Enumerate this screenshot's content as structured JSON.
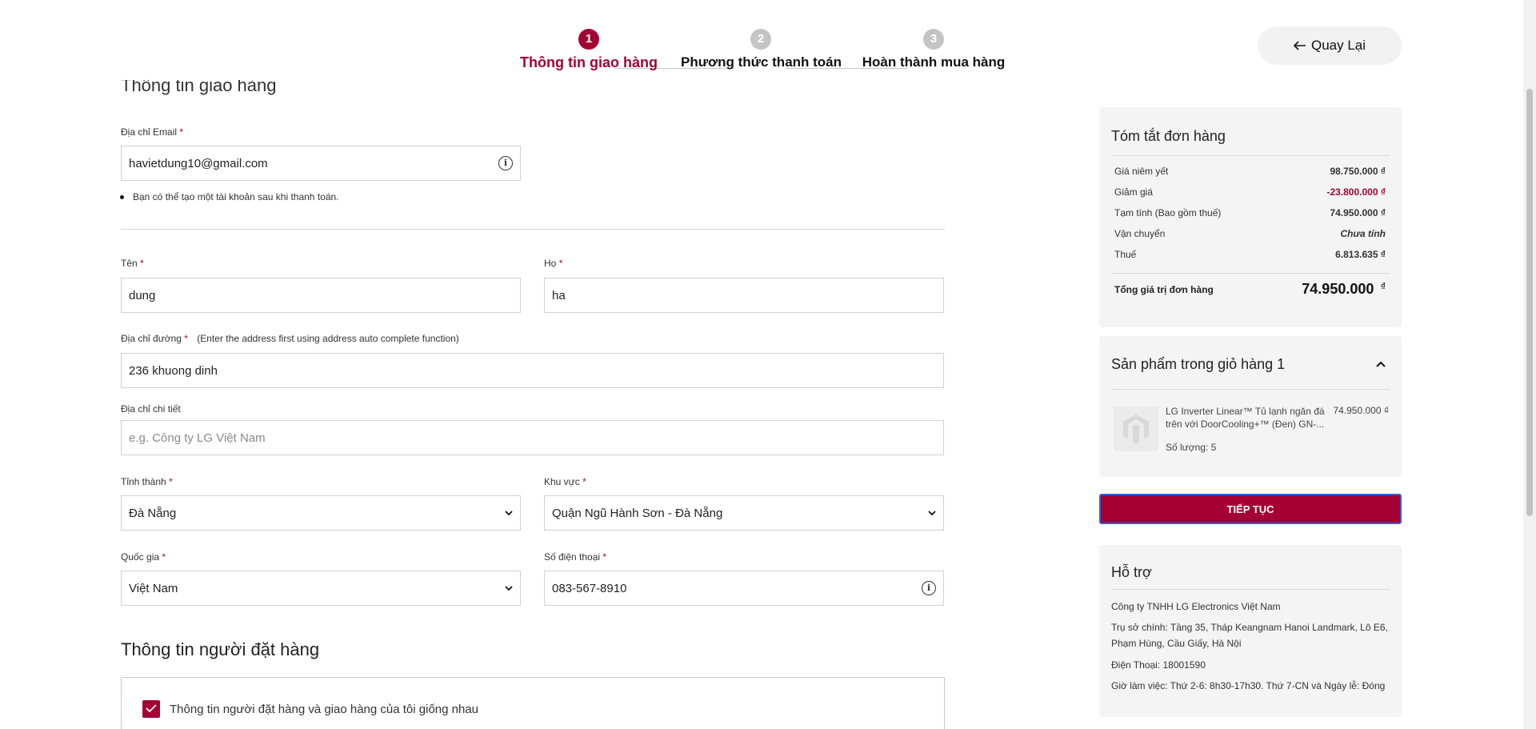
{
  "stepper": {
    "steps": [
      {
        "number": "1",
        "label": "Thông tin giao hàng"
      },
      {
        "number": "2",
        "label": "Phương thức thanh toán"
      },
      {
        "number": "3",
        "label": "Hoàn thành mua hàng"
      }
    ],
    "active_step": 1
  },
  "back_button": {
    "label": "Quay Lại",
    "icon": "arrow-left-icon"
  },
  "shipping": {
    "title": "Thông tin giao hàng",
    "email_label": "Địa chỉ Email",
    "email_value": "havietdung10@gmail.com",
    "email_hint": "Bạn có thể tạo một tài khoản sau khi thanh toán.",
    "first_name_label": "Tên",
    "first_name_value": "dung",
    "last_name_label": "Họ",
    "last_name_value": "ha",
    "street_label": "Địa chỉ đường",
    "street_note": "(Enter the address first using address auto complete function)",
    "street_value": "236 khuong dinh",
    "detail_label": "Địa chỉ chi tiết",
    "detail_placeholder": "e.g. Công ty LG Việt Nam",
    "province_label": "Tỉnh thành",
    "province_value": "Đà Nẵng",
    "district_label": "Khu vực",
    "district_value": "Quận Ngũ Hành Sơn - Đà Nẵng",
    "country_label": "Quốc gia",
    "country_value": "Việt Nam",
    "phone_label": "Số điện thoại",
    "phone_value": "083-567-8910",
    "required_mark": "*"
  },
  "orderer": {
    "title": "Thông tin người đặt hàng",
    "same_as_shipping_label": "Thông tin người đặt hàng và giao hàng của tôi giống nhau",
    "same_as_shipping_checked": true
  },
  "summary": {
    "title": "Tóm tắt đơn hàng",
    "rows": [
      {
        "label": "Giá niêm yết",
        "value": "98.750.000 ₫"
      },
      {
        "label": "Giảm giá",
        "value": "-23.800.000 ₫"
      },
      {
        "label": "Tạm tính (Bao gồm thuế)",
        "value": "74.950.000 ₫"
      },
      {
        "label": "Vận chuyển",
        "value": "Chưa tính"
      },
      {
        "label": "Thuế",
        "value": "6.813.635 ₫"
      }
    ],
    "total_label": "Tổng giá trị đơn hàng",
    "total_value": "74.950.000",
    "total_currency": "₫"
  },
  "cart": {
    "title": "Sản phẩm trong giỏ hàng 1",
    "items": [
      {
        "name": "LG Inverter Linear™ Tủ lạnh ngăn đá trên với DoorCooling+™ (Đen) GN-...",
        "price": "74.950.000 ₫",
        "quantity": "Số lượng: 5"
      }
    ]
  },
  "continue_button": {
    "label": "TIẾP TỤC"
  },
  "support": {
    "title": "Hỗ trợ",
    "company": "Công ty TNHH LG Electronics Việt Nam",
    "address": "Trụ sở chính: Tầng 35, Tháp Keangnam Hanoi Landmark, Lô E6, Phạm Hùng, Cầu Giấy, Hà Nội",
    "phone": "Điện Thoại: 18001590",
    "hours": "Giờ làm việc: Thứ 2-6: 8h30-17h30. Thứ 7-CN và Ngày lễ: Đóng"
  },
  "colors": {
    "brand": "#a50034",
    "focus_border": "#3c5ccf"
  }
}
